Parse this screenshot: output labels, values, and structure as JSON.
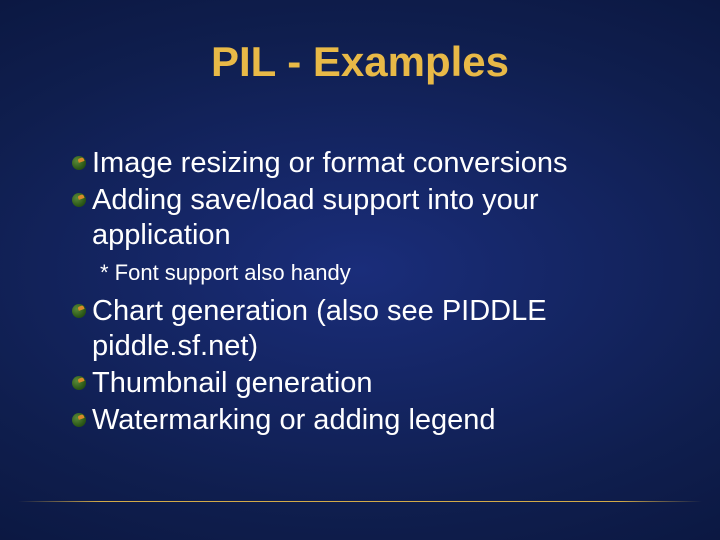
{
  "title": "PIL - Examples",
  "bullets": {
    "b0": "Image resizing or format conversions",
    "b1": "Adding save/load support into your application",
    "note": "* Font support also handy",
    "b2": "Chart generation (also see PIDDLE piddle.sf.net)",
    "b3": "Thumbnail generation",
    "b4": "Watermarking or adding legend"
  }
}
